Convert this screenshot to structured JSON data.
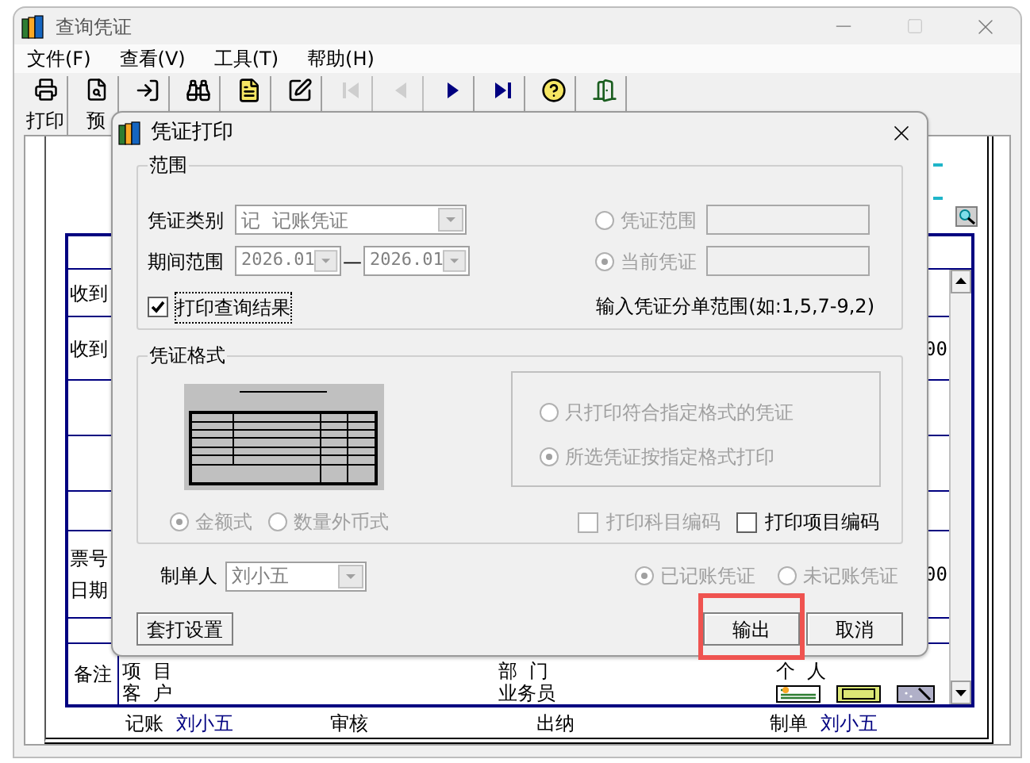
{
  "window": {
    "title": "查询凭证"
  },
  "menu": [
    "文件(F)",
    "查看(V)",
    "工具(T)",
    "帮助(H)"
  ],
  "toolbar": [
    {
      "kind": "print",
      "label": "打印",
      "disabled": false
    },
    {
      "kind": "preview",
      "label": "预",
      "disabled": false
    },
    {
      "kind": "import",
      "disabled": false
    },
    {
      "kind": "find",
      "disabled": false
    },
    {
      "kind": "list",
      "disabled": false
    },
    {
      "kind": "edit",
      "disabled": false
    },
    {
      "kind": "first",
      "disabled": true
    },
    {
      "kind": "prev",
      "disabled": true
    },
    {
      "kind": "next",
      "disabled": false
    },
    {
      "kind": "last",
      "disabled": false
    },
    {
      "kind": "help",
      "disabled": false
    },
    {
      "kind": "exit",
      "disabled": false
    }
  ],
  "document": {
    "rows": [
      {
        "kind": "blank"
      },
      {
        "kind": "text",
        "label": "收到"
      },
      {
        "kind": "text",
        "label": "收到",
        "value": "00"
      },
      {
        "kind": "blank"
      },
      {
        "kind": "blank"
      },
      {
        "kind": "blank"
      },
      {
        "kind": "text",
        "label": "票号",
        "label_2": "日期",
        "value": "00"
      }
    ],
    "notes": {
      "label": "备注",
      "line_1": [
        "项  目",
        "部  门",
        "个  人"
      ],
      "line_2": [
        "客  户",
        "业务员"
      ]
    },
    "footer": [
      {
        "label": "记账",
        "value": "刘小五"
      },
      {
        "label": "审核"
      },
      {
        "label": "出纳"
      },
      {
        "label": "制单",
        "value": "刘小五"
      }
    ]
  },
  "dialog": {
    "title": "凭证打印",
    "range": {
      "title": "范围",
      "type_label": "凭证类别",
      "type_value": "记  记账凭证",
      "period_label": "期间范围",
      "period_from": "2026.01",
      "period_separator": "—",
      "period_to": "2026.01",
      "print_result": {
        "label": "打印查询结果",
        "checked": true
      },
      "scope_options": [
        {
          "label": "凭证范围",
          "selected": false,
          "disabled": true
        },
        {
          "label": "当前凭证",
          "selected": true,
          "disabled": true
        }
      ],
      "hint": "输入凭证分单范围(如:1,5,7-9,2)"
    },
    "format": {
      "title": "凭证格式",
      "format_options": [
        {
          "label": "只打印符合指定格式的凭证",
          "selected": false,
          "disabled": true
        },
        {
          "label": "所选凭证按指定格式打印",
          "selected": true,
          "disabled": true
        }
      ],
      "style_options": [
        {
          "label": "金额式",
          "selected": true,
          "disabled": true
        },
        {
          "label": "数量外币式",
          "selected": false,
          "disabled": true
        }
      ],
      "checkboxes": [
        {
          "label": "打印科目编码",
          "checked": false,
          "disabled": true
        },
        {
          "label": "打印项目编码",
          "checked": false,
          "disabled": false
        }
      ]
    },
    "maker_label": "制单人",
    "maker_value": "刘小五",
    "status_options": [
      {
        "label": "已记账凭证",
        "selected": true,
        "disabled": true
      },
      {
        "label": "未记账凭证",
        "selected": false,
        "disabled": true
      }
    ],
    "buttons": [
      {
        "label": "套打设置",
        "highlighted": false
      },
      {
        "label": "输出",
        "highlighted": true
      },
      {
        "label": "取消",
        "highlighted": false
      }
    ]
  }
}
